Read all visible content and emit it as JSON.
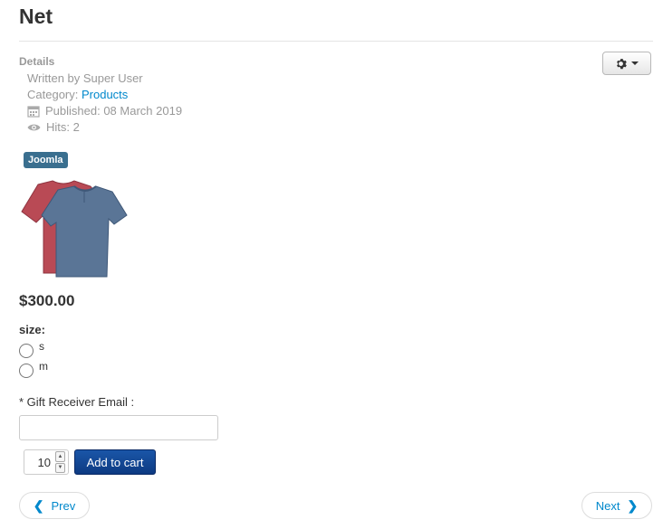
{
  "article": {
    "title": "Net",
    "details_label": "Details",
    "written_by": "Written by Super User",
    "category_prefix": "Category: ",
    "category_link": "Products",
    "published": "Published: 08 March 2019",
    "hits": "Hits: 2",
    "tag": "Joomla"
  },
  "product": {
    "price": "$300.00",
    "size_label": "size:",
    "size_options": [
      "s",
      "m"
    ],
    "gift_label": "* Gift Receiver Email :",
    "gift_value": "",
    "quantity": "10",
    "add_to_cart": "Add to cart"
  },
  "pager": {
    "prev": "Prev",
    "next": "Next"
  },
  "colors": {
    "link": "#0088cc",
    "tag_bg": "#3a6f8f",
    "cart_button": "#0d3a82"
  }
}
